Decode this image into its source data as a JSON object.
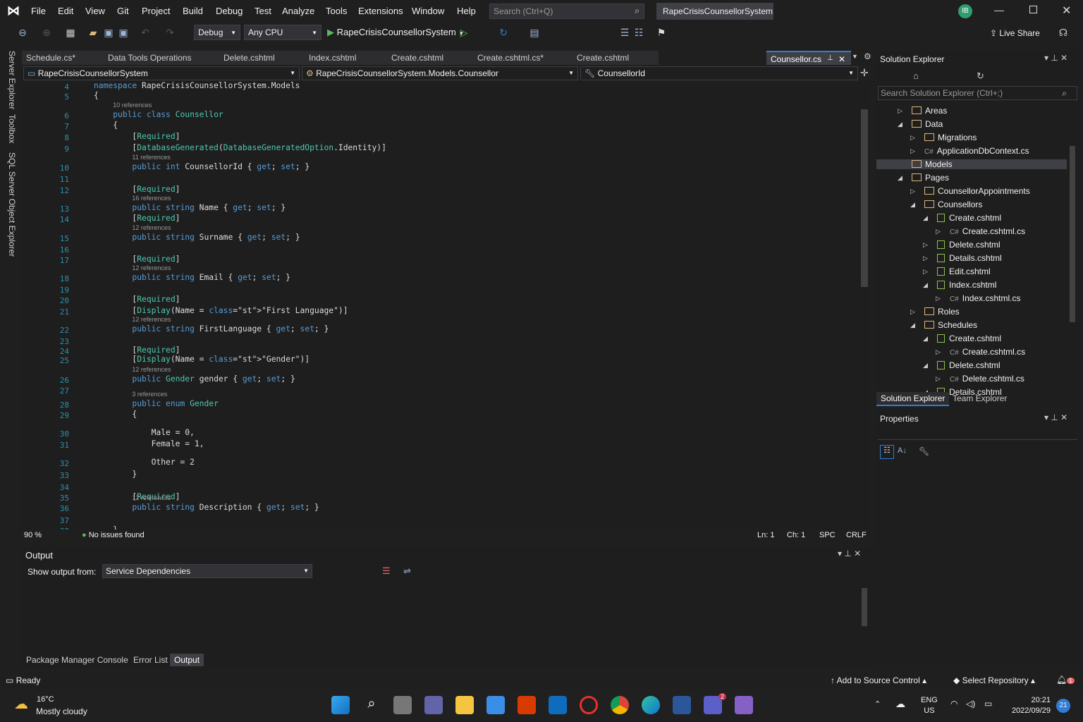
{
  "menu": [
    "File",
    "Edit",
    "View",
    "Git",
    "Project",
    "Build",
    "Debug",
    "Test",
    "Analyze",
    "Tools",
    "Extensions",
    "Window",
    "Help"
  ],
  "search_placeholder": "Search (Ctrl+Q)",
  "solution_title": "RapeCrisisCounsellorSystem",
  "avatar_initials": "IB",
  "toolbar": {
    "config": "Debug",
    "platform": "Any CPU",
    "run_target": "RapeCrisisCounsellorSystem",
    "live_share": "Live Share"
  },
  "tabs": [
    "Schedule.cs*",
    "Data Tools Operations",
    "Delete.cshtml",
    "Index.cshtml",
    "Create.cshtml",
    "Create.cshtml.cs*",
    "Create.cshtml"
  ],
  "active_tab": "Counsellor.cs",
  "nav": {
    "project": "RapeCrisisCounsellorSystem",
    "type": "RapeCrisisCounsellorSystem.Models.Counsellor",
    "member": "CounsellorId"
  },
  "side_tabs": [
    "Server Explorer",
    "Toolbox",
    "SQL Server Object Explorer"
  ],
  "code_lines": [
    {
      "n": "4",
      "t": "namespace RapeCrisisCounsellorSystem.Models"
    },
    {
      "n": "5",
      "t": "{"
    },
    {
      "n": "6",
      "t": "    public class Counsellor",
      "r": "10 references"
    },
    {
      "n": "7",
      "t": "    {"
    },
    {
      "n": "8",
      "t": "        [Required]"
    },
    {
      "n": "9",
      "t": "        [DatabaseGenerated(DatabaseGeneratedOption.Identity)]"
    },
    {
      "n": "10",
      "t": "        public int CounsellorId { get; set; }",
      "r": "11 references"
    },
    {
      "n": "11",
      "t": ""
    },
    {
      "n": "12",
      "t": "        [Required]"
    },
    {
      "n": "13",
      "t": "        public string Name { get; set; }",
      "r": "16 references"
    },
    {
      "n": "14",
      "t": "        [Required]"
    },
    {
      "n": "15",
      "t": "        public string Surname { get; set; }",
      "r": "12 references"
    },
    {
      "n": "16",
      "t": ""
    },
    {
      "n": "17",
      "t": "        [Required]"
    },
    {
      "n": "18",
      "t": "        public string Email { get; set; }",
      "r": "12 references"
    },
    {
      "n": "19",
      "t": ""
    },
    {
      "n": "20",
      "t": "        [Required]"
    },
    {
      "n": "21",
      "t": "        [Display(Name = \"First Language\")]"
    },
    {
      "n": "22",
      "t": "        public string FirstLanguage { get; set; }",
      "r": "12 references"
    },
    {
      "n": "23",
      "t": ""
    },
    {
      "n": "24",
      "t": "        [Required]"
    },
    {
      "n": "25",
      "t": "        [Display(Name = \"Gender\")]"
    },
    {
      "n": "26",
      "t": "        public Gender gender { get; set; }",
      "r": "12 references"
    },
    {
      "n": "27",
      "t": ""
    },
    {
      "n": "28",
      "t": "        public enum Gender",
      "r": "3 references"
    },
    {
      "n": "29",
      "t": "        {"
    },
    {
      "n": "30",
      "t": "            Male = 0,"
    },
    {
      "n": "31",
      "t": "            Female = 1,"
    },
    {
      "n": "32",
      "t": "            Other = 2"
    },
    {
      "n": "33",
      "t": "        }"
    },
    {
      "n": "34",
      "t": ""
    },
    {
      "n": "35",
      "t": "        [Required]"
    },
    {
      "n": "36",
      "t": "        public string Description { get; set; }",
      "r": "12 references"
    },
    {
      "n": "37",
      "t": ""
    },
    {
      "n": "38",
      "t": "    }"
    }
  ],
  "editor_status": {
    "zoom": "90 %",
    "issues": "No issues found",
    "ln": "Ln: 1",
    "ch": "Ch: 1",
    "spc": "SPC",
    "crlf": "CRLF"
  },
  "output": {
    "title": "Output",
    "show_from_label": "Show output from:",
    "source": "Service Dependencies"
  },
  "bottom_tabs": [
    "Package Manager Console",
    "Error List",
    "Output"
  ],
  "solution_explorer": {
    "title": "Solution Explorer",
    "search_placeholder": "Search Solution Explorer (Ctrl+;)",
    "items": [
      {
        "label": "Areas",
        "kind": "folder",
        "tri": "▷"
      },
      {
        "label": "Data",
        "kind": "folder",
        "tri": "◢"
      },
      {
        "label": "Migrations",
        "kind": "folder",
        "tri": "▷"
      },
      {
        "label": "ApplicationDbContext.cs",
        "kind": "cs",
        "tri": "▷"
      },
      {
        "label": "Models",
        "kind": "folder",
        "tri": "▷"
      },
      {
        "label": "Pages",
        "kind": "folder",
        "tri": "◢"
      },
      {
        "label": "CounsellorAppointments",
        "kind": "folder",
        "tri": "▷"
      },
      {
        "label": "Counsellors",
        "kind": "folder",
        "tri": "◢"
      },
      {
        "label": "Create.cshtml",
        "kind": "page",
        "tri": "◢"
      },
      {
        "label": "Create.cshtml.cs",
        "kind": "cs",
        "tri": "▷"
      },
      {
        "label": "Delete.cshtml",
        "kind": "page",
        "tri": "▷"
      },
      {
        "label": "Details.cshtml",
        "kind": "page",
        "tri": "▷"
      },
      {
        "label": "Edit.cshtml",
        "kind": "page",
        "tri": "▷"
      },
      {
        "label": "Index.cshtml",
        "kind": "page",
        "tri": "◢"
      },
      {
        "label": "Index.cshtml.cs",
        "kind": "cs",
        "tri": "▷"
      },
      {
        "label": "Roles",
        "kind": "folder",
        "tri": "▷"
      },
      {
        "label": "Schedules",
        "kind": "folder",
        "tri": "◢"
      },
      {
        "label": "Create.cshtml",
        "kind": "page",
        "tri": "◢"
      },
      {
        "label": "Create.cshtml.cs",
        "kind": "cs",
        "tri": "▷"
      },
      {
        "label": "Delete.cshtml",
        "kind": "page",
        "tri": "◢"
      },
      {
        "label": "Delete.cshtml.cs",
        "kind": "cs",
        "tri": "▷"
      },
      {
        "label": "Details.cshtml",
        "kind": "page",
        "tri": "◢"
      }
    ],
    "tabs": [
      "Solution Explorer",
      "Team Explorer"
    ]
  },
  "properties": {
    "title": "Properties"
  },
  "statusbar": {
    "ready": "Ready",
    "source_control": "Add to Source Control",
    "repo": "Select Repository",
    "notif_count": "1"
  },
  "taskbar": {
    "temp": "16°C",
    "weather": "Mostly cloudy",
    "lang1": "ENG",
    "lang2": "US",
    "time": "20:21",
    "date": "2022/09/29",
    "badge": "21",
    "teams_badge": "2"
  },
  "colors": {
    "accent": "#2f7dd6",
    "keyword": "#569cd6",
    "type": "#4ec9b0",
    "string": "#d69d85",
    "vs_purple": "#8661c5"
  }
}
